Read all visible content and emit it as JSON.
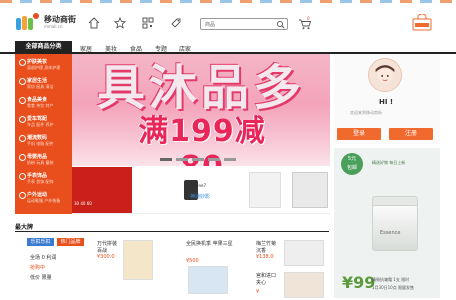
{
  "header": {
    "logo_text": "移动商街",
    "logo_sub": "mmall.cn",
    "search_placeholder": "商品",
    "cart_count": "0"
  },
  "nav": {
    "all_categories": "全部商品分类",
    "items": [
      "家居",
      "美妆",
      "食品",
      "专题",
      "店家"
    ]
  },
  "categories": [
    {
      "title": "护肤美妆",
      "sub": "面部护理 身体护理"
    },
    {
      "title": "家居生活",
      "sub": "家纺 厨具 清洁"
    },
    {
      "title": "食品美食",
      "sub": "零食 茶饮 特产"
    },
    {
      "title": "爱车驾配",
      "sub": "车品 配件 养护"
    },
    {
      "title": "潮流数码",
      "sub": "手机 电脑 配件"
    },
    {
      "title": "母婴用品",
      "sub": "奶粉 玩具 童装"
    },
    {
      "title": "手表饰品",
      "sub": "手表 首饰 配饰"
    },
    {
      "title": "户外运动",
      "sub": "运动鞋服 户外装备"
    }
  ],
  "banner": {
    "headline": "具沐品多",
    "promo": "满199减80"
  },
  "strip": {
    "tile1_price": "30 40 60",
    "iphone_label": "iPhone7",
    "shen_label": "神通妙影"
  },
  "user": {
    "greeting": "HI !",
    "welcome": "欢迎来到移动商街",
    "login": "登录",
    "register": "注册"
  },
  "ad": {
    "badge_line1": "5元",
    "badge_line2": "包邮",
    "line1": "精选好物 每日上新",
    "cream_label": "Essence",
    "price": "¥99",
    "line2": "精致抗皱霜 1支 限时",
    "line3": "1月30日10点 限量发售"
  },
  "section": {
    "title": "最大牌",
    "badge1": "乐扣乐扣",
    "badge2": "热门品牌",
    "promo1": "全场 0 利润",
    "promo2": "抢购中",
    "promo3": "低价 限量",
    "products": [
      {
        "name": "万代拼装 百战",
        "price": "¥300.0"
      },
      {
        "name": "全民换机季 苹果三星",
        "price": "¥500"
      },
      {
        "name": "梅兰竹菊 沉香",
        "price": "¥138.0"
      },
      {
        "name": "宫和进口 夹心",
        "price": "¥"
      }
    ]
  }
}
